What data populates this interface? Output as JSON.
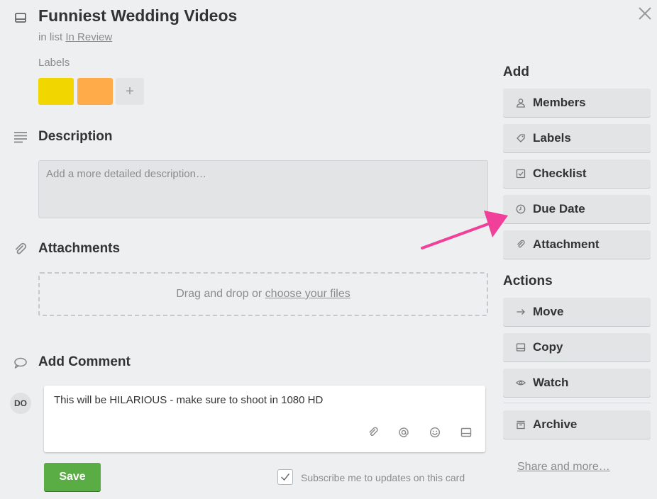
{
  "card": {
    "title": "Funniest Wedding Videos",
    "in_list_prefix": "in list",
    "list_name": "In Review"
  },
  "labels": {
    "heading": "Labels",
    "chips": [
      {
        "color": "#f2d600"
      },
      {
        "color": "#ffab4a"
      }
    ],
    "add_label": "+"
  },
  "description": {
    "title": "Description",
    "placeholder": "Add a more detailed description…"
  },
  "attachments": {
    "title": "Attachments",
    "drop_prefix": "Drag and drop or",
    "choose_link": "choose your files"
  },
  "comment": {
    "title": "Add Comment",
    "avatar_initials": "DO",
    "text": "This will be HILARIOUS - make sure to shoot in 1080 HD",
    "save_label": "Save",
    "subscribe_label": "Subscribe me to updates on this card",
    "subscribe_checked": true
  },
  "sidebar": {
    "add_heading": "Add",
    "add_buttons": [
      {
        "label": "Members",
        "icon": "person-icon"
      },
      {
        "label": "Labels",
        "icon": "tag-icon"
      },
      {
        "label": "Checklist",
        "icon": "checklist-icon"
      },
      {
        "label": "Due Date",
        "icon": "clock-icon"
      },
      {
        "label": "Attachment",
        "icon": "paperclip-icon"
      }
    ],
    "actions_heading": "Actions",
    "action_buttons": [
      {
        "label": "Move",
        "icon": "arrow-right-icon"
      },
      {
        "label": "Copy",
        "icon": "card-icon"
      },
      {
        "label": "Watch",
        "icon": "eye-icon"
      },
      {
        "label": "Archive",
        "icon": "archive-icon"
      }
    ],
    "share_link": "Share and more…"
  },
  "colors": {
    "background": "#edeff0",
    "save_green": "#5aac44",
    "annotation_arrow": "#f0409a"
  }
}
